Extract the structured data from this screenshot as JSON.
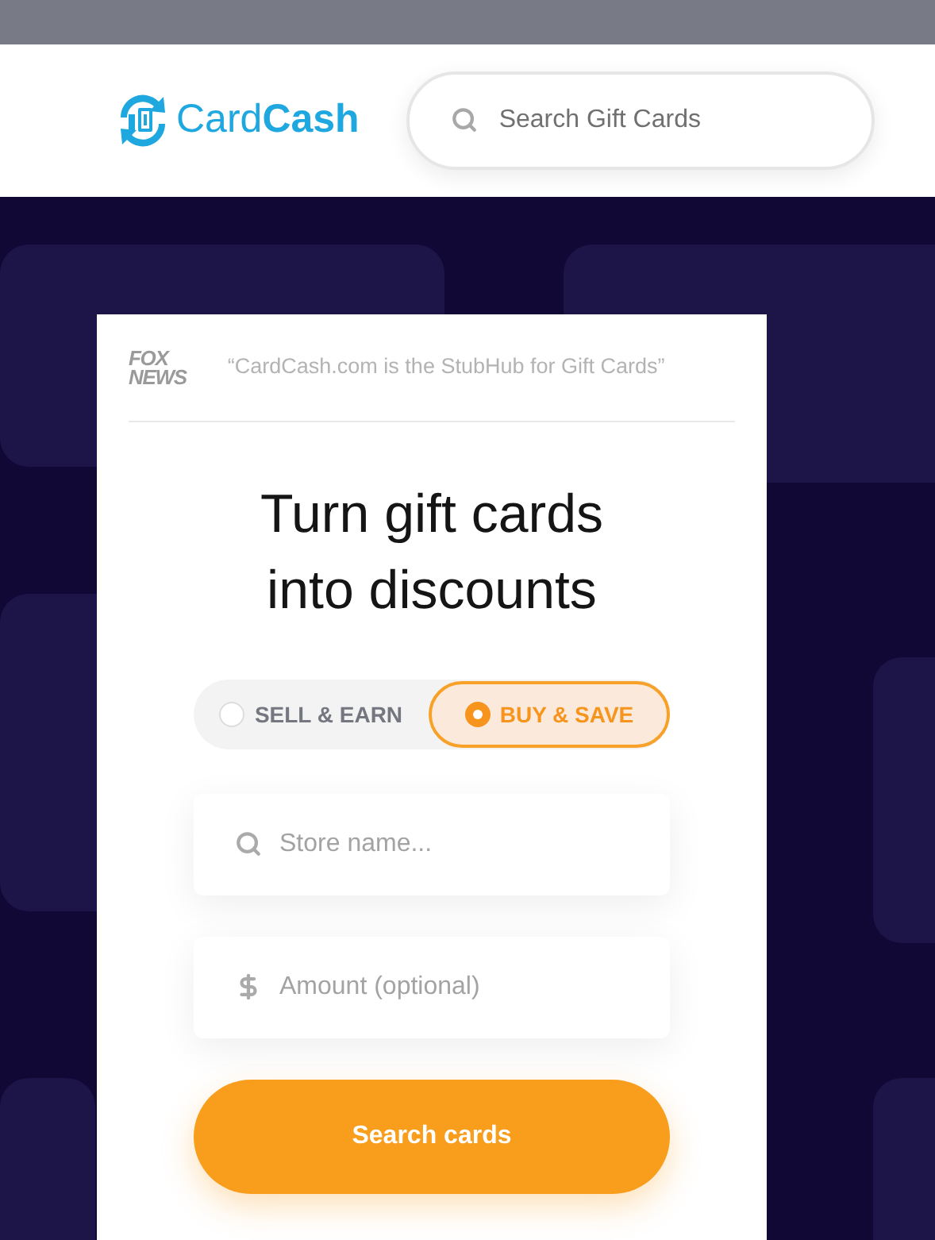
{
  "header": {
    "logo": "Card**Cash**",
    "search": {
      "placeholder": "Search Gift Cards"
    }
  },
  "press": {
    "logo_lines": [
      "FOX",
      "NEWS"
    ],
    "quote": "“CardCash.com is the StubHub for Gift Cards”"
  },
  "hero": {
    "title_lines": [
      "Turn gift cards",
      "into discounts"
    ]
  },
  "modes": [
    {
      "label": "SELL & EARN",
      "selected": false
    },
    {
      "label": "BUY & SAVE",
      "selected": true
    }
  ],
  "fields": [
    {
      "kind": "search",
      "placeholder": "Store name..."
    },
    {
      "kind": "dollar",
      "placeholder": "Amount (optional)"
    }
  ],
  "submit": "Search cards"
}
